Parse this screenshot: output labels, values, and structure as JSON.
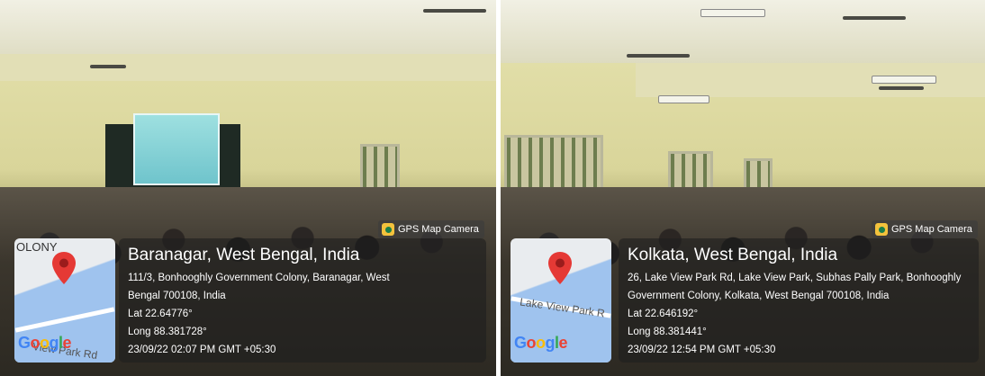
{
  "left": {
    "badge": "GPS Map Camera",
    "map_corner_text": "OLONY",
    "map_road_label": "View Park Rd",
    "google_logo": "Google",
    "title": "Baranagar, West Bengal, India",
    "address_line1": "111/3, Bonhooghly Government Colony, Baranagar, West",
    "address_line2": "Bengal 700108, India",
    "lat": "Lat 22.64776°",
    "long": "Long 88.381728°",
    "timestamp": "23/09/22 02:07 PM GMT +05:30"
  },
  "right": {
    "badge": "GPS Map Camera",
    "map_road_label": "Lake View Park R",
    "google_logo": "Google",
    "title": "Kolkata, West Bengal, India",
    "address_line1": "26, Lake View Park Rd, Lake View Park, Subhas Pally Park, Bonhooghly",
    "address_line2": "Government Colony, Kolkata, West Bengal 700108, India",
    "lat": "Lat 22.646192°",
    "long": "Long 88.381441°",
    "timestamp": "23/09/22 12:54 PM GMT +05:30"
  },
  "colors": {
    "marker": "#e53935",
    "water": "#9fc3ee",
    "google_blue": "#4285F4",
    "google_red": "#EA4335",
    "google_yellow": "#FBBC05",
    "google_green": "#34A853"
  }
}
